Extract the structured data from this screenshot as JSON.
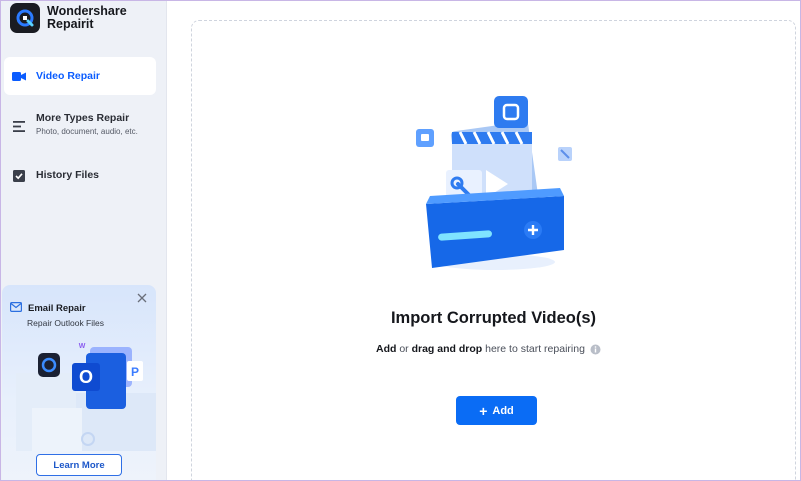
{
  "app": {
    "name_line1": "Wondershare",
    "name_line2": "Repairit",
    "logo_icon": "repairit-logo-icon"
  },
  "sidebar": {
    "items": [
      {
        "label": "Video Repair",
        "icon": "video-camera-icon",
        "active": true
      },
      {
        "label": "More Types Repair",
        "sub": "Photo, document, audio, etc.",
        "icon": "menu-lines-icon",
        "active": false
      },
      {
        "label": "History Files",
        "icon": "checkbox-icon",
        "active": false
      }
    ],
    "promo": {
      "title": "Email Repair",
      "subtitle": "Repair Outlook Files",
      "button": "Learn More",
      "icons": [
        "mail-icon",
        "close-icon",
        "outlook-icon"
      ]
    }
  },
  "main": {
    "title": "Import Corrupted Video(s)",
    "hint_add": "Add",
    "hint_or": " or ",
    "hint_drag": "drag and drop",
    "hint_rest": " here to start repairing",
    "add_button": "Add",
    "accent": "#0a6cf5"
  }
}
